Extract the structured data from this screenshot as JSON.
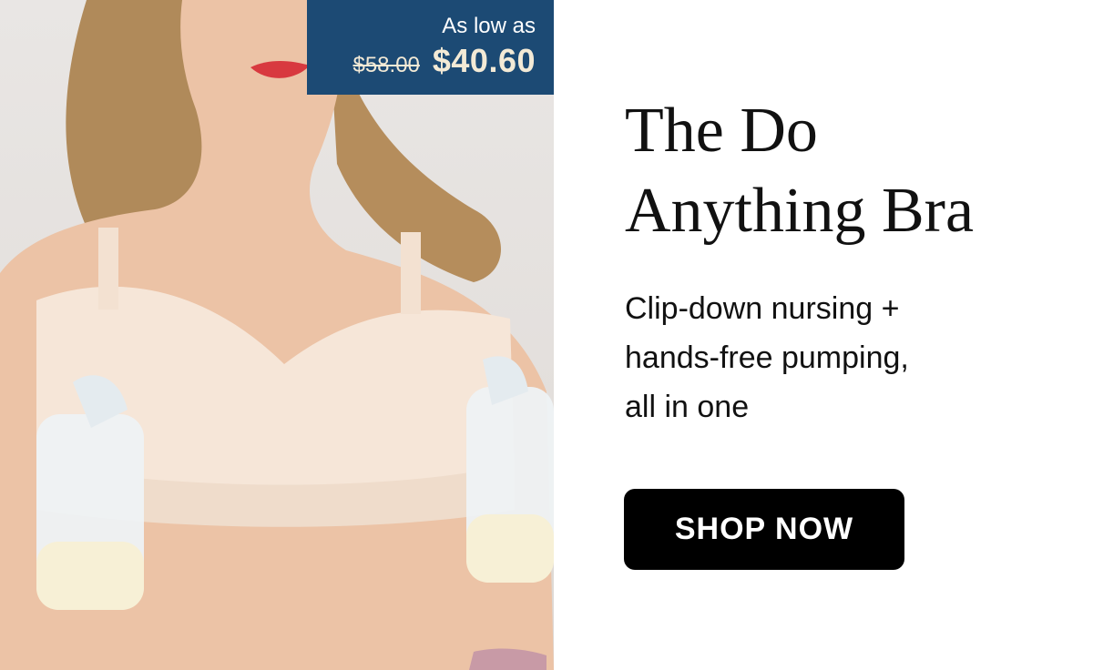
{
  "price_badge": {
    "label": "As low as",
    "original_price": "$58.00",
    "sale_price": "$40.60"
  },
  "headline": {
    "line1": "The Do",
    "line2": "Anything Bra"
  },
  "subhead": {
    "line1": "Clip-down nursing +",
    "line2": "hands-free pumping,",
    "line3": "all in one"
  },
  "cta": {
    "label": "SHOP NOW"
  },
  "colors": {
    "badge_background": "#1c4a74",
    "price_text": "#f3ead6",
    "cta_background": "#000000",
    "cta_text": "#ffffff",
    "headline_text": "#111111"
  }
}
